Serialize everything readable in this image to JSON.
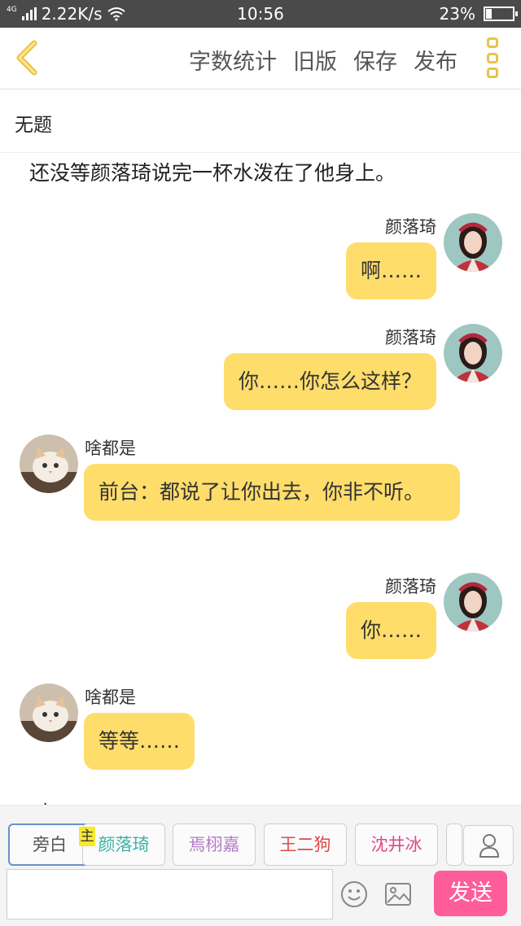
{
  "status_bar": {
    "network": "4G",
    "speed": "2.22K/s",
    "time": "10:56",
    "battery": "23%",
    "battery_level": 0.23
  },
  "toolbar": {
    "back_icon": "chevron-left-icon",
    "actions": [
      "字数统计",
      "旧版",
      "保存",
      "发布"
    ],
    "more_icon": "more-vertical-icon",
    "accent": "#e8c24b"
  },
  "title": "无题",
  "narration": "还没等颜落琦说完一杯水泼在了他身上。",
  "messages": [
    {
      "speaker": "颜落琦",
      "side": "right",
      "text": "啊……"
    },
    {
      "speaker": "颜落琦",
      "side": "right",
      "text": "你……你怎么这样？"
    },
    {
      "speaker": "啥都是",
      "side": "left",
      "text": "前台：都说了让你出去，你非不听。"
    },
    {
      "speaker": "颜落琦",
      "side": "right",
      "text": "你……"
    },
    {
      "speaker": "啥都是",
      "side": "left",
      "text": "等等……"
    }
  ],
  "cut_text": "占",
  "bubble_color": "#fedd6b",
  "characters": [
    {
      "name": "旁白",
      "color": "#555555",
      "selected": true
    },
    {
      "name": "颜落琦",
      "color": "#3bb3a6",
      "main": true
    },
    {
      "name": "焉栩嘉",
      "color": "#b07cc6"
    },
    {
      "name": "王二狗",
      "color": "#e0484b"
    },
    {
      "name": "沈井冰",
      "color": "#e04a8a"
    }
  ],
  "main_tag": "主",
  "input": {
    "value": "",
    "placeholder": ""
  },
  "send_label": "发送",
  "send_color": "#fe5d9a",
  "icons": {
    "user": "user-icon",
    "emoji": "smiley-icon",
    "image": "image-icon"
  }
}
